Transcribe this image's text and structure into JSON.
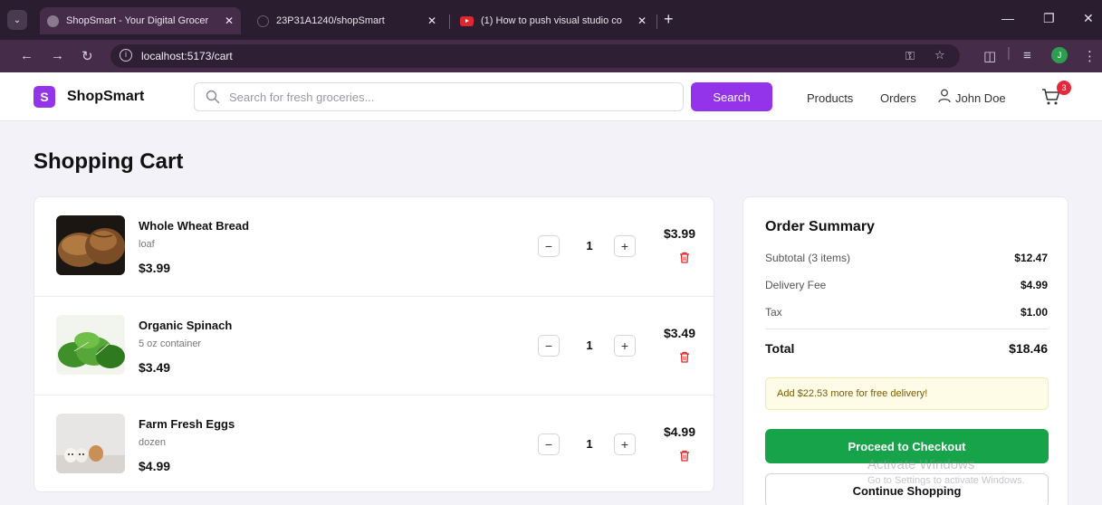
{
  "browser": {
    "tabs": [
      {
        "title": "ShopSmart - Your Digital Grocer",
        "active": true
      },
      {
        "title": "23P31A1240/shopSmart",
        "active": false
      },
      {
        "title": "(1) How to push visual studio co",
        "active": false
      }
    ],
    "url": "localhost:5173/cart",
    "profile_initial": "J",
    "new_tab": "+"
  },
  "header": {
    "logo_letter": "S",
    "brand": "ShopSmart",
    "search_placeholder": "Search for fresh groceries...",
    "search_button": "Search",
    "nav": {
      "products": "Products",
      "orders": "Orders",
      "user": "John Doe"
    },
    "cart_count": "3"
  },
  "page": {
    "title": "Shopping Cart"
  },
  "cart": {
    "items": [
      {
        "name": "Whole Wheat Bread",
        "unit": "loaf",
        "price": "$3.99",
        "qty": "1",
        "line_total": "$3.99"
      },
      {
        "name": "Organic Spinach",
        "unit": "5 oz container",
        "price": "$3.49",
        "qty": "1",
        "line_total": "$3.49"
      },
      {
        "name": "Farm Fresh Eggs",
        "unit": "dozen",
        "price": "$4.99",
        "qty": "1",
        "line_total": "$4.99"
      }
    ]
  },
  "summary": {
    "title": "Order Summary",
    "subtotal_label": "Subtotal (3 items)",
    "subtotal": "$12.47",
    "delivery_label": "Delivery Fee",
    "delivery": "$4.99",
    "tax_label": "Tax",
    "tax": "$1.00",
    "total_label": "Total",
    "total": "$18.46",
    "promo": "Add $22.53 more for free delivery!",
    "checkout_button": "Proceed to Checkout",
    "continue_button": "Continue Shopping"
  },
  "watermark": {
    "title": "Activate Windows",
    "subtitle": "Go to Settings to activate Windows."
  },
  "colors": {
    "brand": "#9333ea",
    "checkout": "#16a34a",
    "badge": "#e5283b",
    "delete": "#dc2626"
  }
}
